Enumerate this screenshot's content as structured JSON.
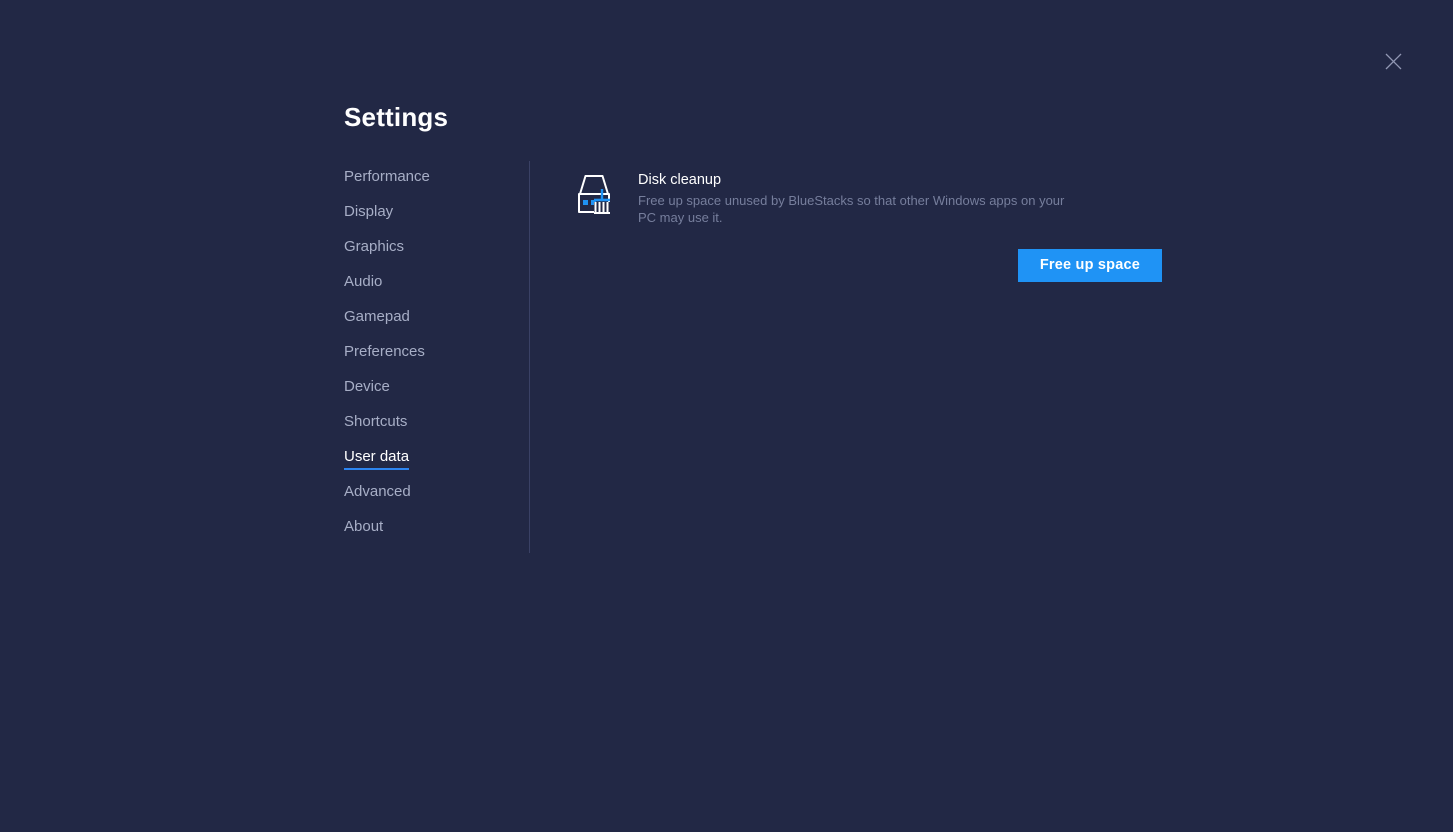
{
  "window": {
    "title": "Settings",
    "close_label": "Close"
  },
  "sidebar": {
    "items": [
      {
        "label": "Performance",
        "active": false
      },
      {
        "label": "Display",
        "active": false
      },
      {
        "label": "Graphics",
        "active": false
      },
      {
        "label": "Audio",
        "active": false
      },
      {
        "label": "Gamepad",
        "active": false
      },
      {
        "label": "Preferences",
        "active": false
      },
      {
        "label": "Device",
        "active": false
      },
      {
        "label": "Shortcuts",
        "active": false
      },
      {
        "label": "User data",
        "active": true
      },
      {
        "label": "Advanced",
        "active": false
      },
      {
        "label": "About",
        "active": false
      }
    ]
  },
  "content": {
    "disk_cleanup": {
      "icon": "disk-cleanup-icon",
      "title": "Disk cleanup",
      "description": "Free up space unused by BlueStacks so that other Windows apps on your PC may use it.",
      "button_label": "Free up space"
    }
  },
  "colors": {
    "background": "#222845",
    "accent_blue": "#1f93f5",
    "active_underline": "#2d85f0",
    "sidebar_text": "#a7aec6",
    "muted_text": "#767e9c",
    "divider": "#3a4165"
  }
}
